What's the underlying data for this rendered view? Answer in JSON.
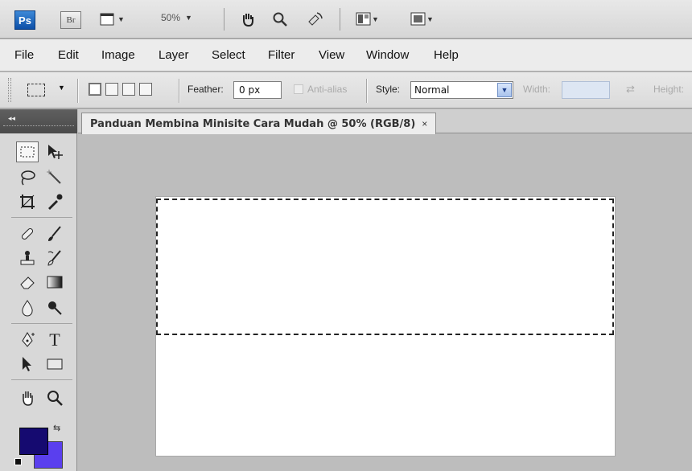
{
  "appbar": {
    "ps_label": "Ps",
    "br_label": "Br",
    "zoom_level": "50%"
  },
  "menu": [
    "File",
    "Edit",
    "Image",
    "Layer",
    "Select",
    "Filter",
    "View",
    "Window",
    "Help"
  ],
  "options": {
    "feather_label": "Feather:",
    "feather_value": "0 px",
    "antialias_label": "Anti-alias",
    "style_label": "Style:",
    "style_value": "Normal",
    "width_label": "Width:",
    "height_label": "Height:"
  },
  "toolbox": {
    "collapse_glyph": "◂◂",
    "foreground_color": "#150a70",
    "background_color": "#5a3fee"
  },
  "document": {
    "tab_title": "Panduan Membina Minisite Cara Mudah @ 50% (RGB/8)",
    "close_glyph": "×"
  }
}
